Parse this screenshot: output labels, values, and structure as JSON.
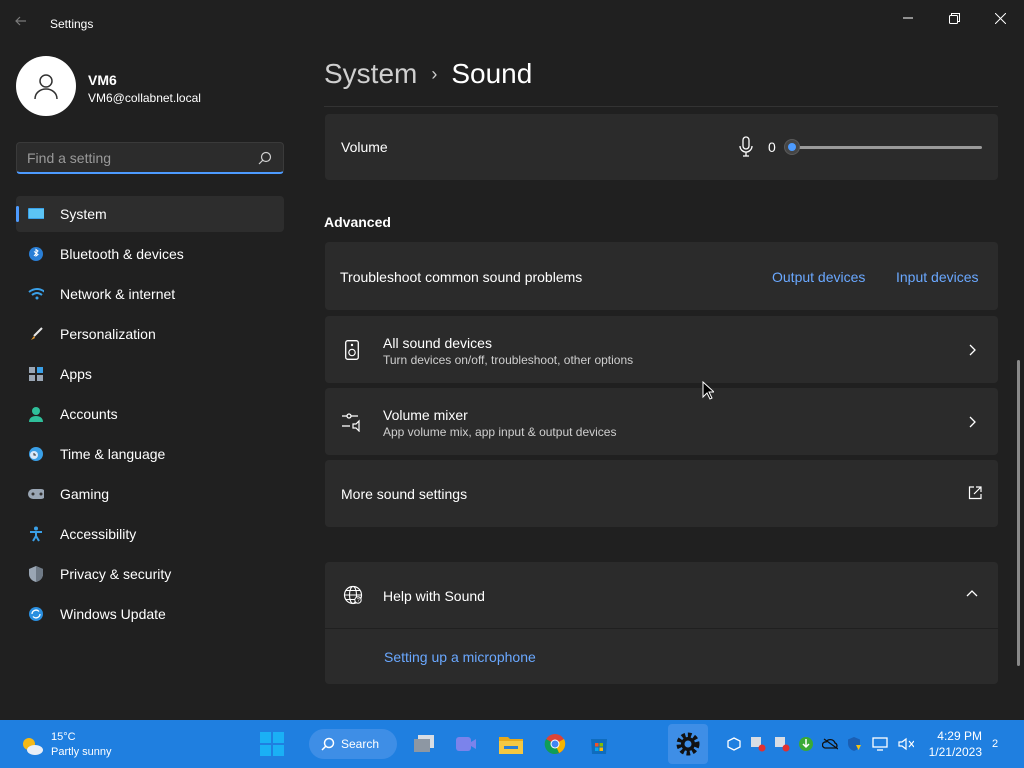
{
  "window": {
    "title": "Settings"
  },
  "profile": {
    "name": "VM6",
    "email": "VM6@collabnet.local"
  },
  "search": {
    "placeholder": "Find a setting"
  },
  "nav": {
    "items": [
      {
        "label": "System",
        "icon": "monitor-icon",
        "active": true
      },
      {
        "label": "Bluetooth & devices",
        "icon": "bluetooth-icon"
      },
      {
        "label": "Network & internet",
        "icon": "wifi-icon"
      },
      {
        "label": "Personalization",
        "icon": "brush-icon"
      },
      {
        "label": "Apps",
        "icon": "apps-icon"
      },
      {
        "label": "Accounts",
        "icon": "person-icon"
      },
      {
        "label": "Time & language",
        "icon": "clock-globe-icon"
      },
      {
        "label": "Gaming",
        "icon": "gamepad-icon"
      },
      {
        "label": "Accessibility",
        "icon": "accessibility-icon"
      },
      {
        "label": "Privacy & security",
        "icon": "shield-icon"
      },
      {
        "label": "Windows Update",
        "icon": "update-icon"
      }
    ]
  },
  "breadcrumb": {
    "parent": "System",
    "separator": "›",
    "current": "Sound"
  },
  "volume": {
    "label": "Volume",
    "value": "0",
    "level": 0
  },
  "advanced": {
    "title": "Advanced",
    "troubleshoot": {
      "label": "Troubleshoot common sound problems",
      "output_link": "Output devices",
      "input_link": "Input devices"
    },
    "all_devices": {
      "label": "All sound devices",
      "sub": "Turn devices on/off, troubleshoot, other options"
    },
    "mixer": {
      "label": "Volume mixer",
      "sub": "App volume mix, app input & output devices"
    },
    "more": {
      "label": "More sound settings"
    }
  },
  "help": {
    "title": "Help with Sound",
    "link": "Setting up a microphone"
  },
  "taskbar": {
    "weather_temp": "15°C",
    "weather_desc": "Partly sunny",
    "search_label": "Search",
    "time": "4:29 PM",
    "date": "1/21/2023",
    "notifications": "2"
  },
  "colors": {
    "accent": "#4d9bff",
    "link": "#6aa8ff",
    "taskbar": "#1f7fe0",
    "background": "#202020",
    "card": "#2b2b2b"
  }
}
